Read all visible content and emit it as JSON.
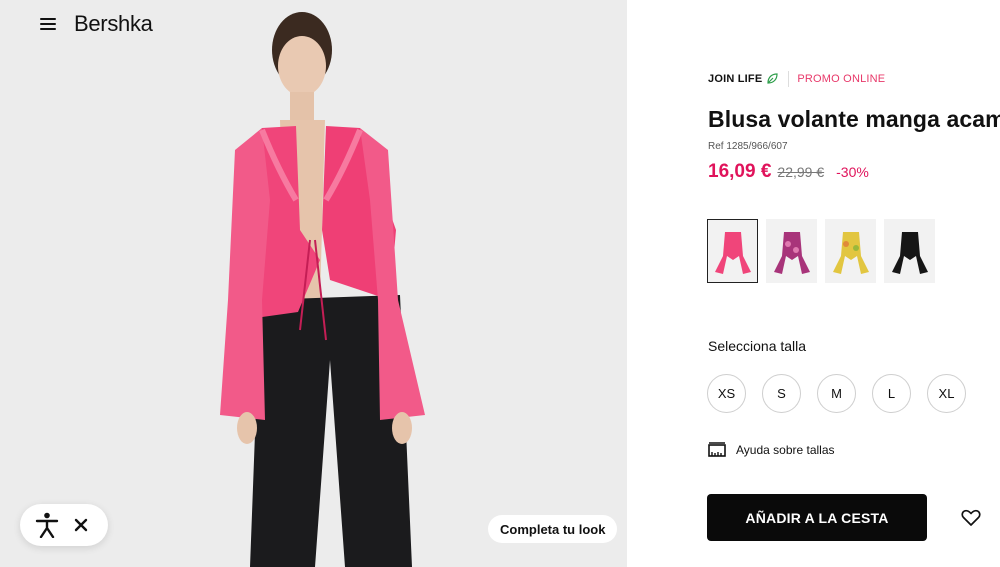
{
  "header": {
    "brand": "Bershka",
    "menu_icon": "hamburger-menu-icon"
  },
  "product": {
    "tags": {
      "sustainability": "JOIN LIFE",
      "promo": "PROMO ONLINE"
    },
    "title": "Blusa volante manga acam",
    "ref": "Ref 1285/966/607",
    "price_current": "16,09 €",
    "price_original": "22,99 €",
    "discount": "-30%",
    "colors": [
      {
        "name": "pink",
        "hex": "#f0457a",
        "selected": true
      },
      {
        "name": "magenta-print",
        "hex": "#a8347a",
        "selected": false
      },
      {
        "name": "yellow-print",
        "hex": "#e2c640",
        "selected": false
      },
      {
        "name": "black",
        "hex": "#161616",
        "selected": false
      }
    ]
  },
  "sizes": {
    "label": "Selecciona talla",
    "options": [
      "XS",
      "S",
      "M",
      "L",
      "XL"
    ]
  },
  "size_help": "Ayuda sobre tallas",
  "cta": {
    "add_to_cart": "AÑADIR A LA CESTA",
    "favorite_icon": "heart-icon"
  },
  "overlays": {
    "complete_look": "Completa tu look",
    "accessibility_icon": "accessibility-icon",
    "close_icon": "close-icon"
  },
  "colors": {
    "accent": "#e0135b",
    "promo": "#e8396a",
    "leaf": "#2e9e4b"
  }
}
